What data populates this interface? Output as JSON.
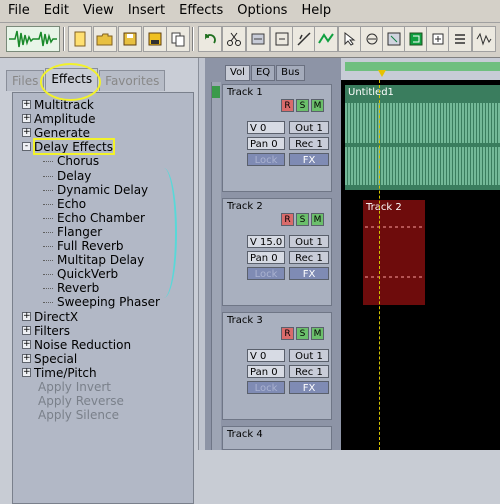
{
  "menu": [
    "File",
    "Edit",
    "View",
    "Insert",
    "Effects",
    "Options",
    "Help"
  ],
  "left_panel": {
    "tabs": [
      "Files",
      "Effects",
      "Favorites"
    ],
    "tree": [
      {
        "label": "Multitrack",
        "type": "folder",
        "state": "+"
      },
      {
        "label": "Amplitude",
        "type": "folder",
        "state": "+"
      },
      {
        "label": "Generate",
        "type": "folder",
        "state": "+"
      },
      {
        "label": "Delay Effects",
        "type": "folder",
        "state": "-"
      },
      {
        "label": "Chorus",
        "type": "child"
      },
      {
        "label": "Delay",
        "type": "child"
      },
      {
        "label": "Dynamic Delay",
        "type": "child"
      },
      {
        "label": "Echo",
        "type": "child"
      },
      {
        "label": "Echo Chamber",
        "type": "child"
      },
      {
        "label": "Flanger",
        "type": "child"
      },
      {
        "label": "Full Reverb",
        "type": "child"
      },
      {
        "label": "Multitap Delay",
        "type": "child"
      },
      {
        "label": "QuickVerb",
        "type": "child"
      },
      {
        "label": "Reverb",
        "type": "child"
      },
      {
        "label": "Sweeping Phaser",
        "type": "child"
      },
      {
        "label": "DirectX",
        "type": "folder",
        "state": "+"
      },
      {
        "label": "Filters",
        "type": "folder",
        "state": "+"
      },
      {
        "label": "Noise Reduction",
        "type": "folder",
        "state": "+"
      },
      {
        "label": "Special",
        "type": "folder",
        "state": "+"
      },
      {
        "label": "Time/Pitch",
        "type": "folder",
        "state": "+"
      },
      {
        "label": "Apply Invert",
        "type": "disabled"
      },
      {
        "label": "Apply Reverse",
        "type": "disabled"
      },
      {
        "label": "Apply Silence",
        "type": "disabled"
      }
    ]
  },
  "track_panel": {
    "tabs": [
      "Vol",
      "EQ",
      "Bus"
    ],
    "tracks": [
      {
        "name": "Track 1",
        "vol": "V 0",
        "pan": "Pan 0",
        "out": "Out 1",
        "rec": "Rec 1",
        "lock": "Lock",
        "fx": "FX",
        "r": "R",
        "s": "S",
        "m": "M"
      },
      {
        "name": "Track 2",
        "vol": "V 15.0",
        "pan": "Pan 0",
        "out": "Out 1",
        "rec": "Rec 1",
        "lock": "Lock",
        "fx": "FX",
        "r": "R",
        "s": "S",
        "m": "M"
      },
      {
        "name": "Track 3",
        "vol": "V 0",
        "pan": "Pan 0",
        "out": "Out 1",
        "rec": "Rec 1",
        "lock": "Lock",
        "fx": "FX",
        "r": "R",
        "s": "S",
        "m": "M"
      },
      {
        "name": "Track 4"
      }
    ]
  },
  "clips": [
    {
      "name": "Untitled1",
      "color": "#3f8f6b"
    },
    {
      "name": "Track 2",
      "color": "#6a0a0a"
    }
  ],
  "toolbar_icons": [
    "waveform-view-icon",
    "new-file-icon",
    "open-file-icon",
    "save-icon",
    "floppy-icon",
    "copy-icon",
    "undo-icon",
    "scissors-icon",
    "mixdown-icon",
    "loop-icon",
    "cut-icon",
    "envelope-icon",
    "cursor-icon",
    "hand-icon",
    "zoom-icon",
    "snap-icon",
    "track-icon",
    "settings-icon",
    "wave-icon"
  ]
}
